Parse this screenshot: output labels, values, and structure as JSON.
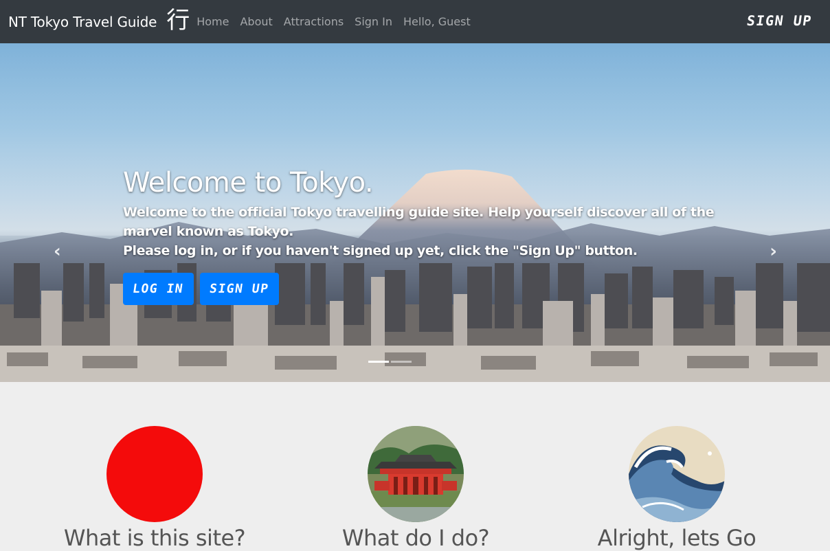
{
  "navbar": {
    "brand": "NT Tokyo Travel Guide",
    "brand_kanji": "行",
    "links": [
      "Home",
      "About",
      "Attractions",
      "Sign In",
      "Hello, Guest"
    ],
    "signup_label": "SIGN UP"
  },
  "hero": {
    "heading": "Welcome to Tokyo.",
    "text_line1": "Welcome to the official Tokyo travelling guide site. Help yourself discover all of the marvel known as Tokyo.",
    "text_line2": "Please log in, or if you haven't signed up yet, click the \"Sign Up\" button.",
    "login_label": "LOG IN",
    "signup_label": "SIGN UP",
    "prev_arrow": "‹",
    "next_arrow": "›",
    "indicators": 2,
    "active_indicator": 0
  },
  "features": [
    {
      "title": "What is this site?",
      "image": "red-sun-circle"
    },
    {
      "title": "What do I do?",
      "image": "temple-photo"
    },
    {
      "title": "Alright, lets Go",
      "image": "great-wave-painting"
    }
  ],
  "colors": {
    "navbar_bg": "#343a40",
    "primary": "#007bff",
    "red_circle": "#f40b0b",
    "page_bg": "#eeeeee"
  }
}
